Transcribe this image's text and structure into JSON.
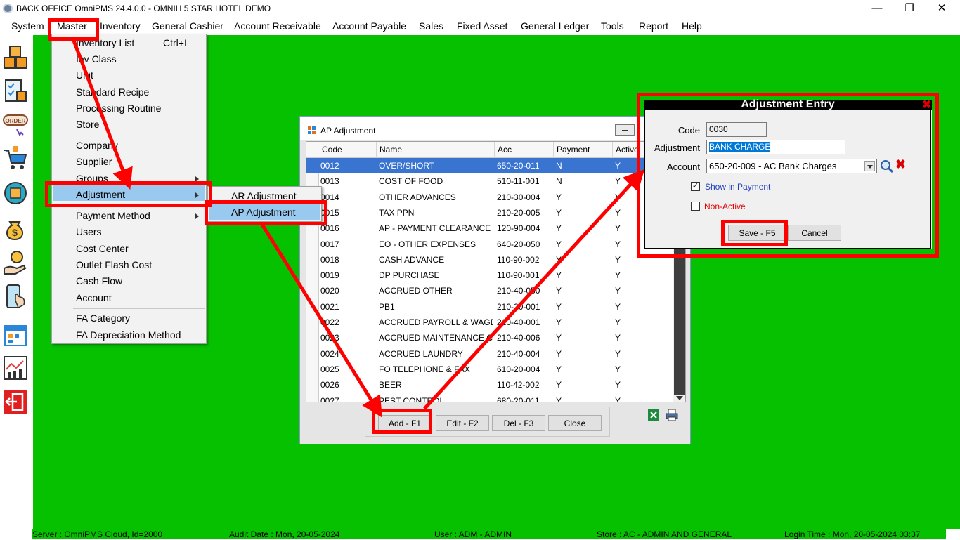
{
  "window": {
    "title": "BACK OFFICE OmniPMS 24.4.0.0 - OMNIH 5 STAR HOTEL DEMO",
    "min_glyph": "—",
    "max_glyph": "❐",
    "close_glyph": "✕"
  },
  "menubar": {
    "items": [
      "System",
      "Master",
      "Inventory",
      "General Cashier",
      "Account Receivable",
      "Account Payable",
      "Sales",
      "Fixed Asset",
      "General Ledger",
      "Tools",
      "Report",
      "Help"
    ]
  },
  "sidebar_icons": [
    "boxes-icon",
    "inventory-checklist-icon",
    "order-icon",
    "shopping-cart-icon",
    "sync-icon",
    "money-bag-icon",
    "cash-hand-icon",
    "mobile-touch-icon",
    "calendar-icon",
    "chart-icon",
    "exit-icon"
  ],
  "sidebar_order_label": "ORDER",
  "master_menu": {
    "items": [
      "Inventory List",
      "Inv Class",
      "Unit",
      "Standard Recipe",
      "Processing Routine",
      "Store",
      "Company",
      "Supplier",
      "Groups",
      "Adjustment",
      "Payment Method",
      "Users",
      "Cost Center",
      "Outlet Flash Cost",
      "Cash Flow",
      "Account",
      "FA Category",
      "FA Depreciation Method"
    ],
    "inventory_list_shortcut": "Ctrl+I"
  },
  "adjustment_submenu": {
    "items": [
      "AR Adjustment",
      "AP Adjustment"
    ]
  },
  "ap_window": {
    "title": "AP Adjustment",
    "columns": [
      "Code",
      "Name",
      "Acc",
      "Payment",
      "Active"
    ],
    "rows": [
      [
        "0012",
        "OVER/SHORT",
        "650-20-011",
        "N",
        "Y"
      ],
      [
        "0013",
        "COST OF FOOD",
        "510-11-001",
        "N",
        "Y"
      ],
      [
        "0014",
        "OTHER ADVANCES",
        "210-30-004",
        "Y",
        "Y"
      ],
      [
        "0015",
        "TAX PPN",
        "210-20-005",
        "Y",
        "Y"
      ],
      [
        "0016",
        "AP - PAYMENT CLEARANCE",
        "120-90-004",
        "Y",
        "Y"
      ],
      [
        "0017",
        "EO - OTHER EXPENSES",
        "640-20-050",
        "Y",
        "Y"
      ],
      [
        "0018",
        "CASH ADVANCE",
        "110-90-002",
        "Y",
        "Y"
      ],
      [
        "0019",
        "DP PURCHASE",
        "110-90-001",
        "Y",
        "Y"
      ],
      [
        "0020",
        "ACCRUED OTHER",
        "210-40-050",
        "Y",
        "Y"
      ],
      [
        "0021",
        "PB1",
        "210-20-001",
        "Y",
        "Y"
      ],
      [
        "0022",
        "ACCRUED PAYROLL & WAGES",
        "210-40-001",
        "Y",
        "Y"
      ],
      [
        "0023",
        "ACCRUED MAINTENANCE CON...",
        "210-40-006",
        "Y",
        "Y"
      ],
      [
        "0024",
        "ACCRUED LAUNDRY",
        "210-40-004",
        "Y",
        "Y"
      ],
      [
        "0025",
        "FO TELEPHONE & FAX",
        "610-20-004",
        "Y",
        "Y"
      ],
      [
        "0026",
        "BEER",
        "110-42-002",
        "Y",
        "Y"
      ],
      [
        "0027",
        "PEST CONTROL",
        "680-20-011",
        "Y",
        "Y"
      ]
    ],
    "buttons": {
      "add": "Add - F1",
      "edit": "Edit - F2",
      "del": "Del - F3",
      "close": "Close"
    }
  },
  "adjustment_entry": {
    "title": "Adjustment Entry",
    "close_glyph": "✖",
    "code_label": "Code",
    "code_value": "0030",
    "adjustment_label": "Adjustment",
    "adjustment_value": "BANK CHARGE",
    "account_label": "Account",
    "account_value": "650-20-009 - AC Bank Charges",
    "show_in_payment_label": "Show in Payment",
    "show_in_payment_checked": true,
    "check_glyph": "✓",
    "non_active_label": "Non-Active",
    "non_active_checked": false,
    "delete_glyph": "✖",
    "save_label": "Save - F5",
    "cancel_label": "Cancel"
  },
  "status": {
    "server": "Server : OmniPMS Cloud, Id=2000",
    "audit": "Audit Date : Mon, 20-05-2024",
    "user": "User : ADM - ADMIN",
    "store": "Store : AC - ADMIN AND GENERAL",
    "login": "Login Time : Mon, 20-05-2024 03:37"
  },
  "colors": {
    "desktop": "#06c100",
    "selection": "#3874d0",
    "menu_highlight": "#99c9ef",
    "annotation": "#ff0000"
  }
}
